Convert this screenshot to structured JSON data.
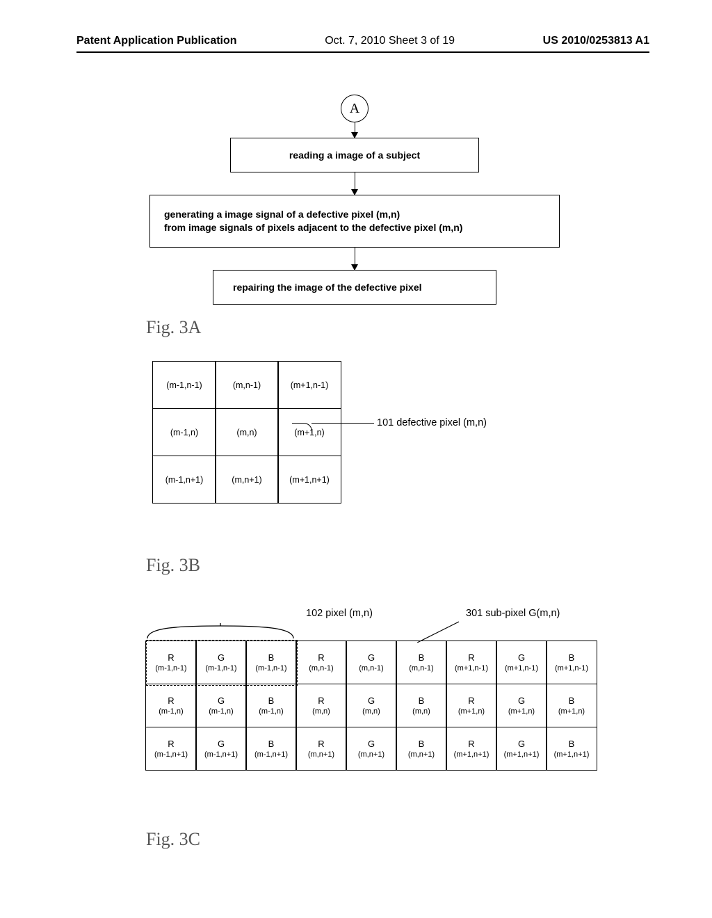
{
  "header": {
    "left": "Patent Application Publication",
    "mid": "Oct. 7, 2010  Sheet 3 of 19",
    "right": "US 2010/0253813 A1"
  },
  "flow": {
    "start": "A",
    "step1": "reading a image of a subject",
    "step2": "generating a image signal of a defective pixel (m,n)\nfrom image signals of pixels adjacent to the defective pixel (m,n)",
    "step3": "repairing the image of the defective pixel"
  },
  "fig3a_caption": "Fig. 3A",
  "grid3": {
    "cells": [
      "(m-1,n-1)",
      "(m,n-1)",
      "(m+1,n-1)",
      "(m-1,n)",
      "(m,n)",
      "(m+1,n)",
      "(m-1,n+1)",
      "(m,n+1)",
      "(m+1,n+1)"
    ],
    "callout": "101 defective pixel (m,n)"
  },
  "fig3b_caption": "Fig. 3B",
  "grid9": {
    "brace_label": "102 pixel (m,n)",
    "sp_label": "301 sub-pixel G(m,n)",
    "rows": [
      [
        {
          "c": "R",
          "i": "(m-1,n-1)"
        },
        {
          "c": "G",
          "i": "(m-1,n-1)"
        },
        {
          "c": "B",
          "i": "(m-1,n-1)"
        },
        {
          "c": "R",
          "i": "(m,n-1)"
        },
        {
          "c": "G",
          "i": "(m,n-1)"
        },
        {
          "c": "B",
          "i": "(m,n-1)"
        },
        {
          "c": "R",
          "i": "(m+1,n-1)"
        },
        {
          "c": "G",
          "i": "(m+1,n-1)"
        },
        {
          "c": "B",
          "i": "(m+1,n-1)"
        }
      ],
      [
        {
          "c": "R",
          "i": "(m-1,n)"
        },
        {
          "c": "G",
          "i": "(m-1,n)"
        },
        {
          "c": "B",
          "i": "(m-1,n)"
        },
        {
          "c": "R",
          "i": "(m,n)"
        },
        {
          "c": "G",
          "i": "(m,n)"
        },
        {
          "c": "B",
          "i": "(m,n)"
        },
        {
          "c": "R",
          "i": "(m+1,n)"
        },
        {
          "c": "G",
          "i": "(m+1,n)"
        },
        {
          "c": "B",
          "i": "(m+1,n)"
        }
      ],
      [
        {
          "c": "R",
          "i": "(m-1,n+1)"
        },
        {
          "c": "G",
          "i": "(m-1,n+1)"
        },
        {
          "c": "B",
          "i": "(m-1,n+1)"
        },
        {
          "c": "R",
          "i": "(m,n+1)"
        },
        {
          "c": "G",
          "i": "(m,n+1)"
        },
        {
          "c": "B",
          "i": "(m,n+1)"
        },
        {
          "c": "R",
          "i": "(m+1,n+1)"
        },
        {
          "c": "G",
          "i": "(m+1,n+1)"
        },
        {
          "c": "B",
          "i": "(m+1,n+1)"
        }
      ]
    ]
  },
  "fig3c_caption": "Fig. 3C"
}
